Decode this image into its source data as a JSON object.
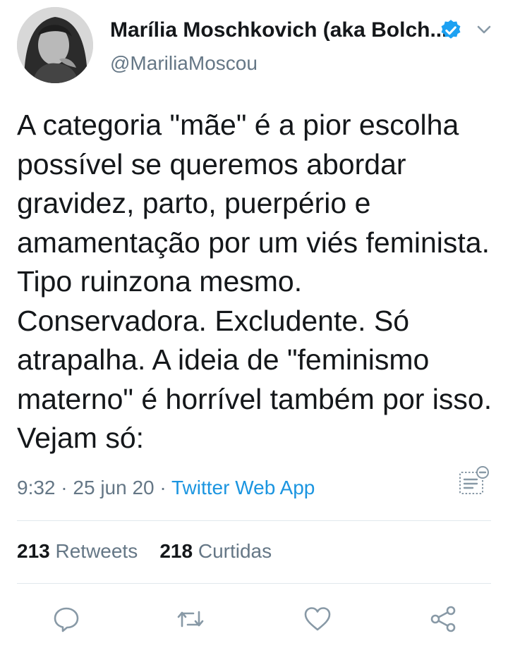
{
  "user": {
    "display_name": "Marília Moschkovich (aka Bolch...",
    "handle": "@MariliaMoscou",
    "verified_icon": "verified-badge-icon",
    "menu_icon": "chevron-down-icon"
  },
  "tweet": {
    "text": "A categoria \"mãe\" é a pior escolha possível se queremos abordar gravidez, parto, puerpério e amamentação por um viés feminista. Tipo ruinzona mesmo. Conservadora. Excludente. Só atrapalha. A ideia de \"feminismo materno\" é horrível também por isso. Vejam só:",
    "time": "9:32",
    "sep1": " · ",
    "date": "25 jun 20",
    "sep2": " · ",
    "source": "Twitter Web App",
    "analytics_icon": "analytics-icon"
  },
  "stats": {
    "retweets_count": "213",
    "retweets_label": " Retweets",
    "likes_count": "218",
    "likes_label": " Curtidas"
  },
  "actions": [
    "reply-icon",
    "retweet-icon",
    "like-icon",
    "share-icon"
  ],
  "colors": {
    "text": "#14171a",
    "secondary": "#657786",
    "link": "#1b95e0",
    "verified": "#1da1f2",
    "divider": "#e1e8ed"
  }
}
